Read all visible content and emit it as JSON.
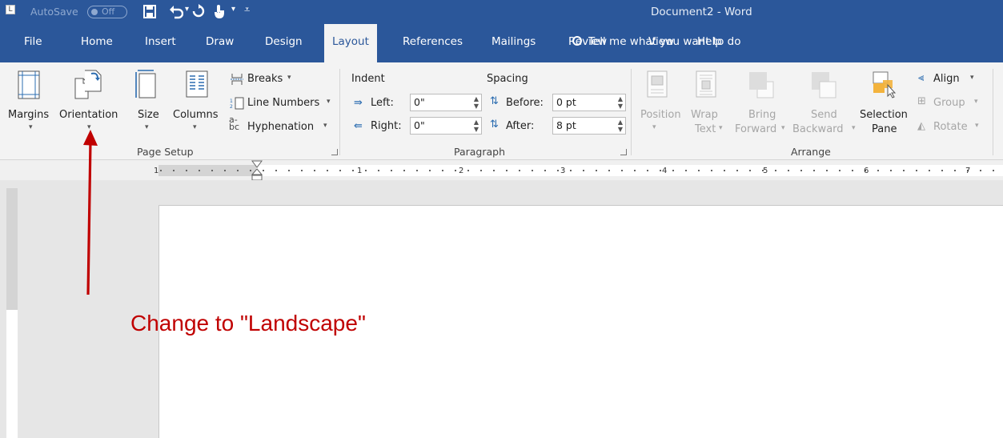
{
  "titlebar": {
    "autosave_label": "AutoSave",
    "autosave_state": "Off",
    "document_title": "Document2  -  Word",
    "qat_icons": [
      "save-icon",
      "undo-icon",
      "redo-icon",
      "touch-mode-icon",
      "customize-qat-icon"
    ]
  },
  "tabs": [
    "File",
    "Home",
    "Insert",
    "Draw",
    "Design",
    "Layout",
    "References",
    "Mailings",
    "Review",
    "View",
    "Help"
  ],
  "active_tab": "Layout",
  "tell_me": "Tell me what you want to do",
  "page_setup": {
    "margins": "Margins",
    "orientation": "Orientation",
    "size": "Size",
    "columns": "Columns",
    "breaks": "Breaks",
    "line_numbers": "Line Numbers",
    "hyphenation": "Hyphenation",
    "group_label": "Page Setup"
  },
  "paragraph": {
    "indent_header": "Indent",
    "spacing_header": "Spacing",
    "left_label": "Left:",
    "left_value": "0\"",
    "right_label": "Right:",
    "right_value": "0\"",
    "before_label": "Before:",
    "before_value": "0 pt",
    "after_label": "After:",
    "after_value": "8 pt",
    "group_label": "Paragraph"
  },
  "arrange": {
    "position": "Position",
    "wrap": "Wrap",
    "wrap2": "Text",
    "bring": "Bring",
    "bring2": "Forward",
    "send": "Send",
    "send2": "Backward",
    "selection": "Selection",
    "selection2": "Pane",
    "align": "Align",
    "group": "Group",
    "rotate": "Rotate",
    "group_label": "Arrange"
  },
  "ruler_numbers": [
    "1",
    "1",
    "2",
    "3",
    "4",
    "5",
    "6",
    "7"
  ],
  "annotation": "Change to \"Landscape\"",
  "colors": {
    "ribbon_blue": "#2b579a",
    "annotation_red": "#c00000"
  }
}
